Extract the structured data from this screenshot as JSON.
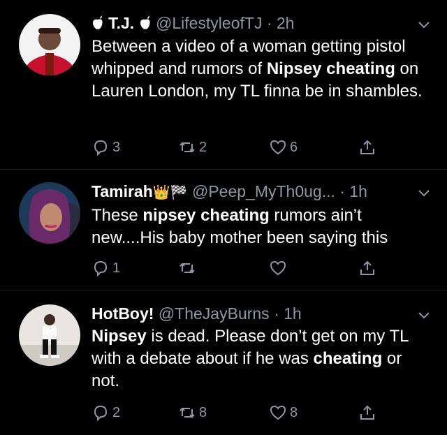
{
  "tweets": [
    {
      "apple1": "",
      "name": "T.J.",
      "apple2": "",
      "handle": "@LifestyleofTJ",
      "time": "· 2h",
      "body": [
        {
          "t": "Between a video of a woman getting pistol whipped and rumors of "
        },
        {
          "t": "Nipsey cheating",
          "b": true
        },
        {
          "t": " on Lauren London, my TL finna be in shambles."
        }
      ],
      "replies": "3",
      "retweets": "2",
      "likes": "6"
    },
    {
      "name": "Tamirah",
      "crown": "👑",
      "flag": "🏁",
      "handle": "@Peep_MyTh0ug...",
      "time": "· 1h",
      "body": [
        {
          "t": "These "
        },
        {
          "t": "nipsey cheating",
          "b": true
        },
        {
          "t": " rumors ain’t new....His baby mother been saying this"
        }
      ],
      "replies": "1",
      "retweets": "",
      "likes": ""
    },
    {
      "name": "HotBoy!",
      "handle": "@TheJayBurns",
      "time": "· 1h",
      "body": [
        {
          "t": "Nipsey",
          "b": true
        },
        {
          "t": " is dead. Please don’t get on my TL with a debate about if he was "
        },
        {
          "t": "cheating",
          "b": true
        },
        {
          "t": " or not."
        }
      ],
      "replies": "2",
      "retweets": "8",
      "likes": "8"
    }
  ],
  "icons": {
    "reply": "reply-icon",
    "retweet": "retweet-icon",
    "like": "heart-icon",
    "share": "share-icon",
    "chevron": "chevron-down-icon"
  },
  "colors": {
    "background": "#000000",
    "muted": "#8b98a5",
    "text": "#ffffff"
  }
}
